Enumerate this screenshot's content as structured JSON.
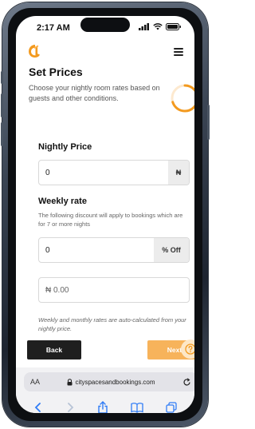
{
  "status": {
    "time": "2:17 AM"
  },
  "page": {
    "title": "Set Prices",
    "subtitle": "Choose your nightly room rates based on guests and other conditions.",
    "progress_fraction": 0.7,
    "accent": "#f39a1f"
  },
  "nightly": {
    "label": "Nightly Price",
    "value": "0",
    "currency": "₦"
  },
  "weekly": {
    "label": "Weekly rate",
    "help": "The following discount will apply to bookings which are for 7 or more nights",
    "discount_value": "0",
    "discount_suffix": "% Off",
    "amount": "₦ 0.00"
  },
  "note": "Weekly and monthly rates are auto-calculated from your nightly price.",
  "footer": {
    "back_label": "Back",
    "next_label": "Next"
  },
  "browser": {
    "aa_label": "AA",
    "url": "cityspacesandbookings.com"
  }
}
